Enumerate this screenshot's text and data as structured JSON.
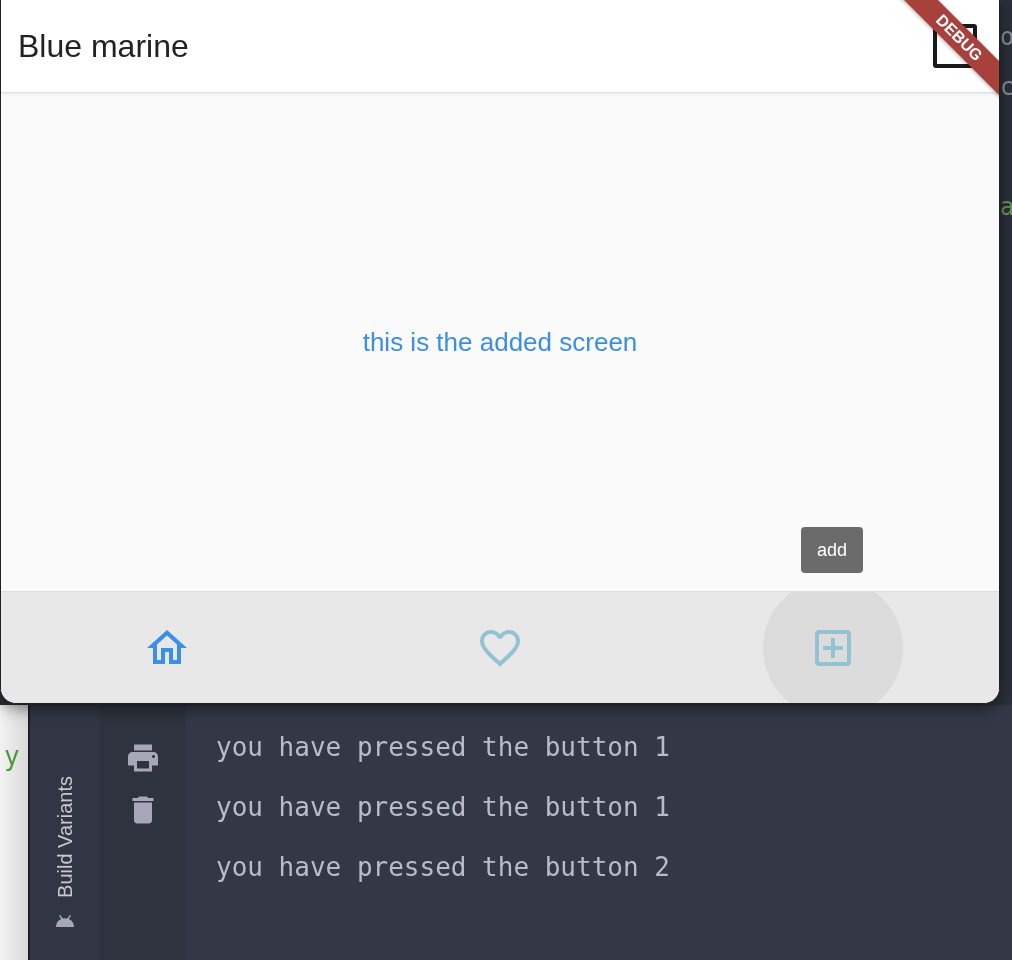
{
  "app": {
    "title": "Blue marine",
    "debug_banner": "DEBUG",
    "body_text": "this is the added screen",
    "tooltip": "add",
    "nav_items": [
      {
        "kind": "home",
        "selected": true,
        "pressed": false
      },
      {
        "kind": "heart",
        "selected": false,
        "pressed": false
      },
      {
        "kind": "add",
        "selected": false,
        "pressed": true
      }
    ]
  },
  "ide": {
    "editor_fragments": [
      "o",
      "c",
      "a"
    ],
    "left_fragment": "y",
    "tool_tab": "Build Variants",
    "console_lines": [
      "you have pressed the button 1",
      "you have pressed the button 1",
      "you have pressed the button 2"
    ]
  }
}
